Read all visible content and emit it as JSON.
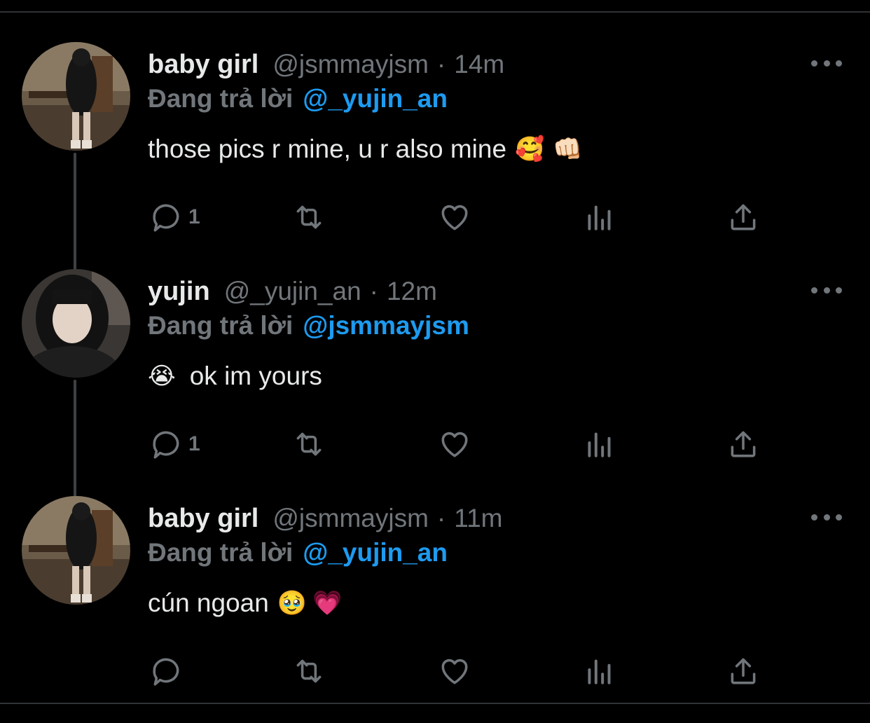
{
  "tweets": [
    {
      "name": "baby girl",
      "handle": "@jsmmayjsm",
      "separator": "·",
      "time": "14m",
      "reply_label": "Đang trả lời",
      "reply_handle": "@_yujin_an",
      "text": "those pics r mine, u r also mine",
      "emojis": [
        "🥰",
        "👊🏻"
      ],
      "reply_count": "1",
      "avatar": "avatar-photo-girl-long-black-coat"
    },
    {
      "name": "yujin",
      "handle": "@_yujin_an",
      "separator": "·",
      "time": "12m",
      "reply_label": "Đang trả lời",
      "reply_handle": "@jsmmayjsm",
      "text": "ok im yours",
      "emojis": [
        "😭"
      ],
      "reply_count": "1",
      "avatar": "avatar-photo-girl-selfie"
    },
    {
      "name": "baby girl",
      "handle": "@jsmmayjsm",
      "separator": "·",
      "time": "11m",
      "reply_label": "Đang trả lời",
      "reply_handle": "@_yujin_an",
      "text": "cún ngoan",
      "emojis": [
        "🥹",
        "💗"
      ],
      "reply_count": "",
      "avatar": "avatar-photo-girl-long-black-coat"
    }
  ],
  "icons": {
    "reply": "reply-icon",
    "retweet": "retweet-icon",
    "like": "heart-icon",
    "views": "views-icon",
    "share": "share-icon",
    "more": "more-icon"
  },
  "colors": {
    "background": "#000000",
    "text": "#e7e9ea",
    "secondary": "#71767b",
    "link": "#1d9bf0",
    "thread_line": "#3e4144"
  }
}
